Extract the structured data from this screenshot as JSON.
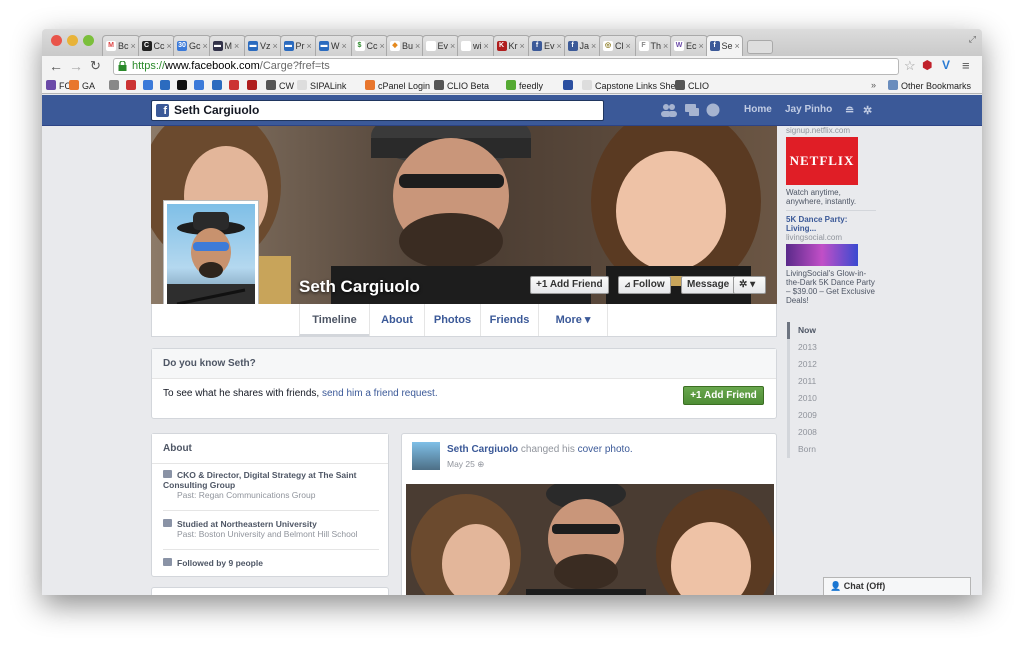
{
  "browser": {
    "tabs": [
      {
        "label": "Bc",
        "fav_text": "M",
        "color": "#ffffff",
        "fg": "#d44"
      },
      {
        "label": "Cc",
        "fav_text": "C",
        "color": "#222222",
        "fg": "#fff"
      },
      {
        "label": "Gc",
        "fav_text": "30",
        "color": "#3b7ad9",
        "fg": "#fff"
      },
      {
        "label": "M",
        "fav_text": "▬",
        "color": "#33334a",
        "fg": "#fff"
      },
      {
        "label": "Vz",
        "fav_text": "▬",
        "color": "#2b6bbf",
        "fg": "#fff"
      },
      {
        "label": "Pr",
        "fav_text": "▬",
        "color": "#2b6bbf",
        "fg": "#fff"
      },
      {
        "label": "W",
        "fav_text": "▬",
        "color": "#2b6bbf",
        "fg": "#fff"
      },
      {
        "label": "Cc",
        "fav_text": "$",
        "color": "#ffffff",
        "fg": "#2a8a2a"
      },
      {
        "label": "Bu",
        "fav_text": "◆",
        "color": "#ffffff",
        "fg": "#e58a1f"
      },
      {
        "label": "Ev",
        "fav_text": "",
        "color": "#ffffff",
        "fg": "#888"
      },
      {
        "label": "wi",
        "fav_text": "",
        "color": "#ffffff",
        "fg": "#888"
      },
      {
        "label": "Kr",
        "fav_text": "K",
        "color": "#b01e1e",
        "fg": "#fff"
      },
      {
        "label": "Ev",
        "fav_text": "f",
        "color": "#3b5998",
        "fg": "#fff"
      },
      {
        "label": "Ja",
        "fav_text": "f",
        "color": "#3b5998",
        "fg": "#fff"
      },
      {
        "label": "Cl",
        "fav_text": "◎",
        "color": "#ffffff",
        "fg": "#8a7a20"
      },
      {
        "label": "Th",
        "fav_text": "F",
        "color": "#ffffff",
        "fg": "#888"
      },
      {
        "label": "Ec",
        "fav_text": "W",
        "color": "#ffffff",
        "fg": "#6b4aa8"
      },
      {
        "label": "Se",
        "fav_text": "f",
        "color": "#3b5998",
        "fg": "#fff"
      }
    ],
    "url_scheme": "https://",
    "url_host": "www.facebook.com",
    "url_path": "/Carge?fref=ts",
    "bookmarks": [
      {
        "label": "FC",
        "color": "#6b4aa8"
      },
      {
        "label": "GA",
        "color": "#e8762d"
      },
      {
        "label": "",
        "color": "#888888"
      },
      {
        "label": "",
        "color": "#cc3333"
      },
      {
        "label": "",
        "color": "#3b7ad9"
      },
      {
        "label": "",
        "color": "#2b6bbf"
      },
      {
        "label": "",
        "color": "#111111"
      },
      {
        "label": "",
        "color": "#3b7ad9"
      },
      {
        "label": "",
        "color": "#2b6bbf"
      },
      {
        "label": "",
        "color": "#cc3333"
      },
      {
        "label": "",
        "color": "#b01e1e"
      },
      {
        "label": "CW",
        "color": "#555555"
      },
      {
        "label": "SIPALink",
        "color": "#dddddd"
      },
      {
        "label": "cPanel Login",
        "color": "#e8762d"
      },
      {
        "label": "CLIO Beta",
        "color": "#555555"
      },
      {
        "label": "feedly",
        "color": "#55aa33"
      },
      {
        "label": "",
        "color": "#2b4fa0"
      },
      {
        "label": "Capstone Links Sheet",
        "color": "#dddddd"
      },
      {
        "label": "CLIO",
        "color": "#555555"
      }
    ],
    "bookmarks_overflow": "»",
    "other_bookmarks": "Other Bookmarks"
  },
  "fb": {
    "search_value": "Seth Cargiuolo",
    "home_link": "Home",
    "user_link": "Jay Pinho",
    "profile_name": "Seth Cargiuolo",
    "add_friend_label": "Add Friend",
    "follow_label": "Follow",
    "message_label": "Message",
    "tabs": [
      "Timeline",
      "About",
      "Photos",
      "Friends",
      "More ▾"
    ],
    "know_header": "Do you know Seth?",
    "know_text": "To see what he shares with friends,",
    "know_link": "send him a friend request.",
    "know_button": "Add Friend",
    "about_header": "About",
    "work_title": "CKO & Director, Digital Strategy at ",
    "work_company": "The Saint Consulting Group",
    "work_past": "Past: Regan Communications Group",
    "edu_title": "Studied at ",
    "edu_school": "Northeastern University",
    "edu_past": "Past: Boston University and Belmont Hill School",
    "followed_text": "Followed by ",
    "followed_link": "9 people",
    "post_author": "Seth Cargiuolo",
    "post_action": " changed his ",
    "post_object": "cover photo.",
    "post_date": "May 25",
    "ad1_url": "signup.netflix.com",
    "ad1_brand": "NETFLIX",
    "ad1_text": "Watch anytime, anywhere, instantly.",
    "ad2_title": "5K Dance Party: Living...",
    "ad2_url": "livingsocial.com",
    "ad2_text": "LivingSocial's Glow-in-the-Dark 5K Dance Party – $39.00 – Get Exclusive Deals!",
    "timeline_years": [
      "Now",
      "2013",
      "2012",
      "2011",
      "2010",
      "2009",
      "2008",
      "Born"
    ],
    "chat_label": "Chat (Off)"
  },
  "colors": {
    "fb_blue": "#3b5998",
    "green_button": "#4e8d35",
    "page_bg": "#e9eaed"
  }
}
